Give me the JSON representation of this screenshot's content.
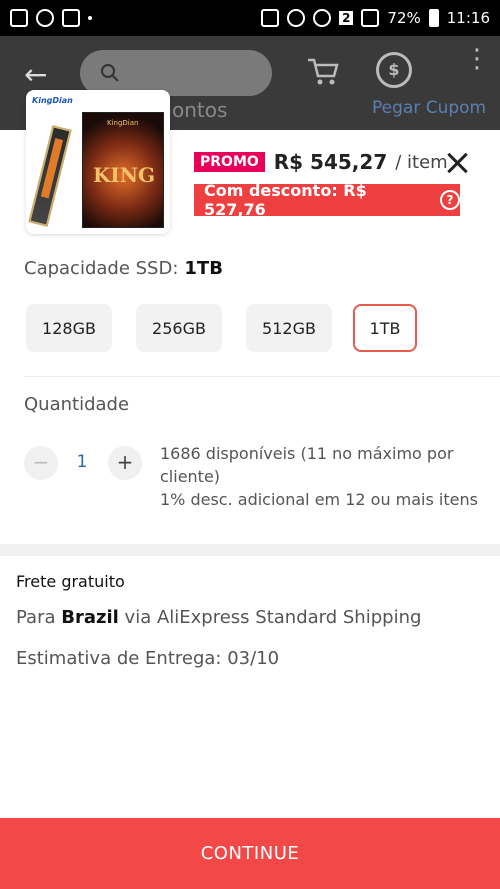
{
  "statusbar": {
    "battery": "72%",
    "time": "11:16",
    "sim_badge": "2"
  },
  "appbar": {
    "search_placeholder": "",
    "behind_left": "ontos",
    "behind_right": "Pegar Cupom"
  },
  "product": {
    "thumb_brand": "KingDian",
    "thumb_box_text": "KING",
    "promo_badge": "PROMO",
    "price": "R$ 545,27",
    "per_item": "/ item",
    "discount_label": "Com desconto: R$ 527,76",
    "discount_help": "?"
  },
  "capacity": {
    "label": "Capacidade SSD:",
    "selected": "1TB",
    "options": [
      "128GB",
      "256GB",
      "512GB",
      "1TB"
    ]
  },
  "quantity": {
    "label": "Quantidade",
    "minus": "−",
    "value": "1",
    "plus": "+",
    "stock_line1": "1686 disponíveis (11 no máximo por cliente)",
    "stock_line2": "1% desc. adicional em 12 ou mais itens"
  },
  "shipping": {
    "title": "Frete gratuito",
    "via_prefix": "Para",
    "country": "Brazil",
    "via_suffix": "via AliExpress Standard Shipping",
    "eta": "Estimativa de Entrega: 03/10"
  },
  "cta": {
    "continue_label": "CONTINUE"
  },
  "colors": {
    "accent": "#f24848",
    "promo": "#e8005a",
    "selected_border": "#e85b4d",
    "qty_value": "#2a6ab5"
  }
}
